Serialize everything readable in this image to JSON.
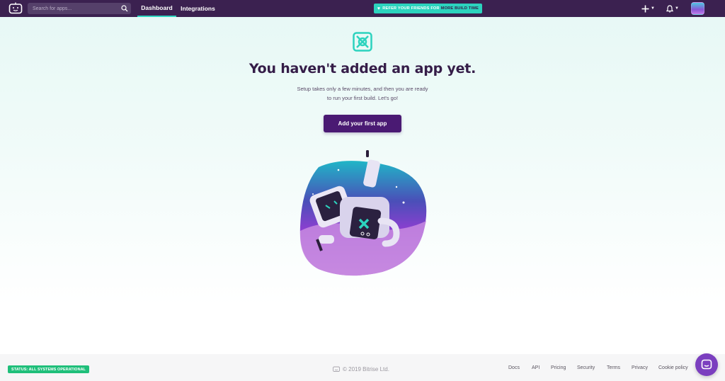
{
  "topbar": {
    "search_placeholder": "Search for apps...",
    "tabs": [
      {
        "label": "Dashboard",
        "active": true
      },
      {
        "label": "Integrations",
        "active": false
      }
    ],
    "refer": {
      "text": "REFER YOUR FRIENDS FOR",
      "highlight": "MORE BUILD TIME"
    },
    "icons": [
      "bitrise-logo-icon",
      "search-icon",
      "plus-icon",
      "bell-icon",
      "avatar"
    ]
  },
  "hero": {
    "title": "You haven't added an app yet.",
    "subtitle_line1": "Setup takes only a few minutes, and then you are ready",
    "subtitle_line2": "to run your first build. Let's go!",
    "cta_label": "Add your first app"
  },
  "footer": {
    "status": "STATUS: ALL SYSTEMS OPERATIONAL",
    "copyright": "© 2019 Bitrise Ltd.",
    "links": [
      "Docs",
      "API",
      "Pricing",
      "Security",
      "Terms",
      "Privacy",
      "Cookie policy"
    ]
  },
  "colors": {
    "topbar_bg": "#3b2150",
    "accent_teal": "#2cd3be",
    "primary_purple": "#4a1a73",
    "status_green": "#1fbf7a",
    "chat_purple": "#7b3fbf"
  }
}
